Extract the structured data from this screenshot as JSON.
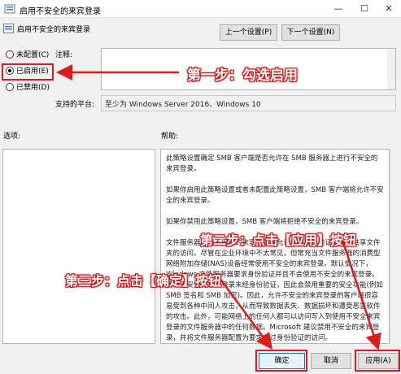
{
  "window": {
    "title": "启用不安全的来宾登录"
  },
  "header": {
    "policy_name": "启用不安全的来宾登录",
    "prev_button": "上一个设置(P)",
    "next_button": "下一个设置(N)"
  },
  "state_options": [
    {
      "label": "未配置(C)",
      "checked": false
    },
    {
      "label": "已启用(E)",
      "checked": true
    },
    {
      "label": "已禁用(D)",
      "checked": false
    }
  ],
  "comment": {
    "label": "注释:",
    "value": ""
  },
  "supported": {
    "label": "支持的平台:",
    "value": "至少为 Windows Server 2016、Windows 10"
  },
  "options": {
    "label": "选项:"
  },
  "help": {
    "label": "帮助:",
    "paragraphs": [
      "此策略设置确定 SMB 客户端是否允许在 SMB 服务器上进行不安全的来宾登录。",
      "如果你启用此策略设置或者未配置此策略设置，SMB 客户端将允许不安全的来宾登录。",
      "如果你禁用此策略设置，SMB 客户端将拒绝不安全的来宾登录。",
      "文件服务器使用不安全的来宾登录来允许未经身份验证的访问共享文件夹的访问。尽管在企业环境中不太常见，但常充当文件服务器的消费型网络附加存储(NAS)设备经常使用不安全的来宾登录。默认情况下，Windows 文件服务器要求身份验证并且不会使用不安全的来宾登录。由于不安全的来宾登录未经身份验证，因此会禁用重要的安全功能(例如 SMB 签名和 SMB 加密)。因此，允许不安全的来宾登录的客户端很容易受到各种中间人攻击，从而导致数据丢失、数据损坏和遭受恶意软件的攻击。此外，可能网络上的任何人都可以访问写入到使用不安全来宾登录的文件服务器中的任何数据。Microsoft 建议禁用不安全的来宾登录，并将文件服务器配置为要求经过身份验证的访问。"
    ]
  },
  "footer": {
    "ok_button": "确定",
    "cancel_button": "取消",
    "apply_button": "应用(A)"
  },
  "annotations": {
    "step1": "第一步：勾选启用",
    "step2": "第二步：点击【应用】按钮",
    "step3": "第三步：点击【确定】按钮"
  },
  "accent_color": "#e01b1b"
}
